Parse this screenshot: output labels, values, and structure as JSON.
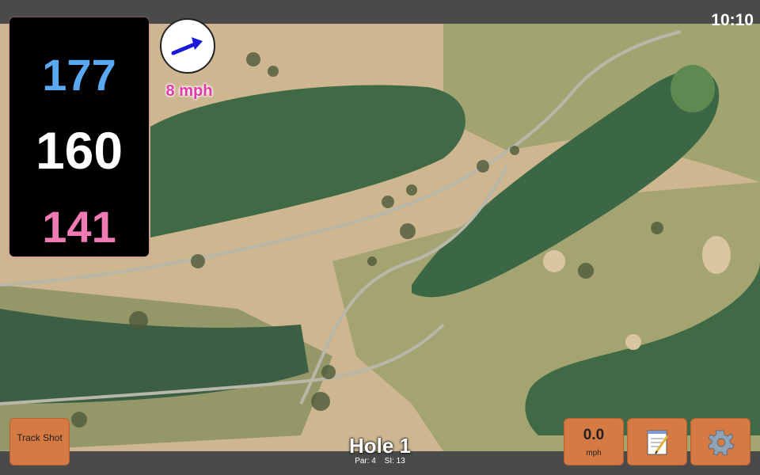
{
  "status": {
    "time": "10:10"
  },
  "distances": {
    "back": "177",
    "center": "160",
    "front": "141"
  },
  "wind": {
    "speed": "8 mph",
    "icon": "wind-arrow-icon"
  },
  "buttons": {
    "track_shot": "Track Shot",
    "speed_value": "0.0",
    "speed_unit": "mph",
    "notes_icon": "notepad-icon",
    "settings_icon": "gear-icon"
  },
  "hole": {
    "title": "Hole 1",
    "par": "Par: 4",
    "si": "SI: 13"
  },
  "colors": {
    "back_distance": "#5aa8f2",
    "center_distance": "#ffffff",
    "front_distance": "#f07ab4",
    "button": "#d57a42",
    "wind_text": "#e03aa8"
  }
}
